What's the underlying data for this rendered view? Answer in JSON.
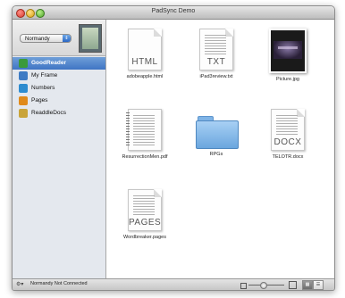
{
  "window": {
    "title": "PadSync Demo"
  },
  "device": {
    "name": "Normandy"
  },
  "sidebar": {
    "apps": [
      {
        "label": "GoodReader",
        "selected": true,
        "icon": "goodreader-icon",
        "color": "#3a9a3a"
      },
      {
        "label": "My Frame",
        "selected": false,
        "icon": "myframe-icon",
        "color": "#3e7bc4"
      },
      {
        "label": "Numbers",
        "selected": false,
        "icon": "numbers-icon",
        "color": "#2e8ccf"
      },
      {
        "label": "Pages",
        "selected": false,
        "icon": "pages-icon",
        "color": "#e08a1a"
      },
      {
        "label": "ReaddleDocs",
        "selected": false,
        "icon": "readdledocs-icon",
        "color": "#c9a43a"
      }
    ]
  },
  "files": [
    {
      "name": "adobeapple.html",
      "kind": "document",
      "ext": "HTML"
    },
    {
      "name": "iPad3review.txt",
      "kind": "document",
      "ext": "TXT"
    },
    {
      "name": "Picture.jpg",
      "kind": "image",
      "ext": ""
    },
    {
      "name": "ResurrectionMen.pdf",
      "kind": "pdf",
      "ext": ""
    },
    {
      "name": "RPGs",
      "kind": "folder",
      "ext": ""
    },
    {
      "name": "TELOTR.docx",
      "kind": "document",
      "ext": "DOCX"
    },
    {
      "name": "Wordbreaker.pages",
      "kind": "document",
      "ext": "PAGES"
    }
  ],
  "status": {
    "text": "Normandy Not Connected"
  },
  "colors": {
    "selection": "#3f74c4",
    "folder": "#6aa6de"
  }
}
